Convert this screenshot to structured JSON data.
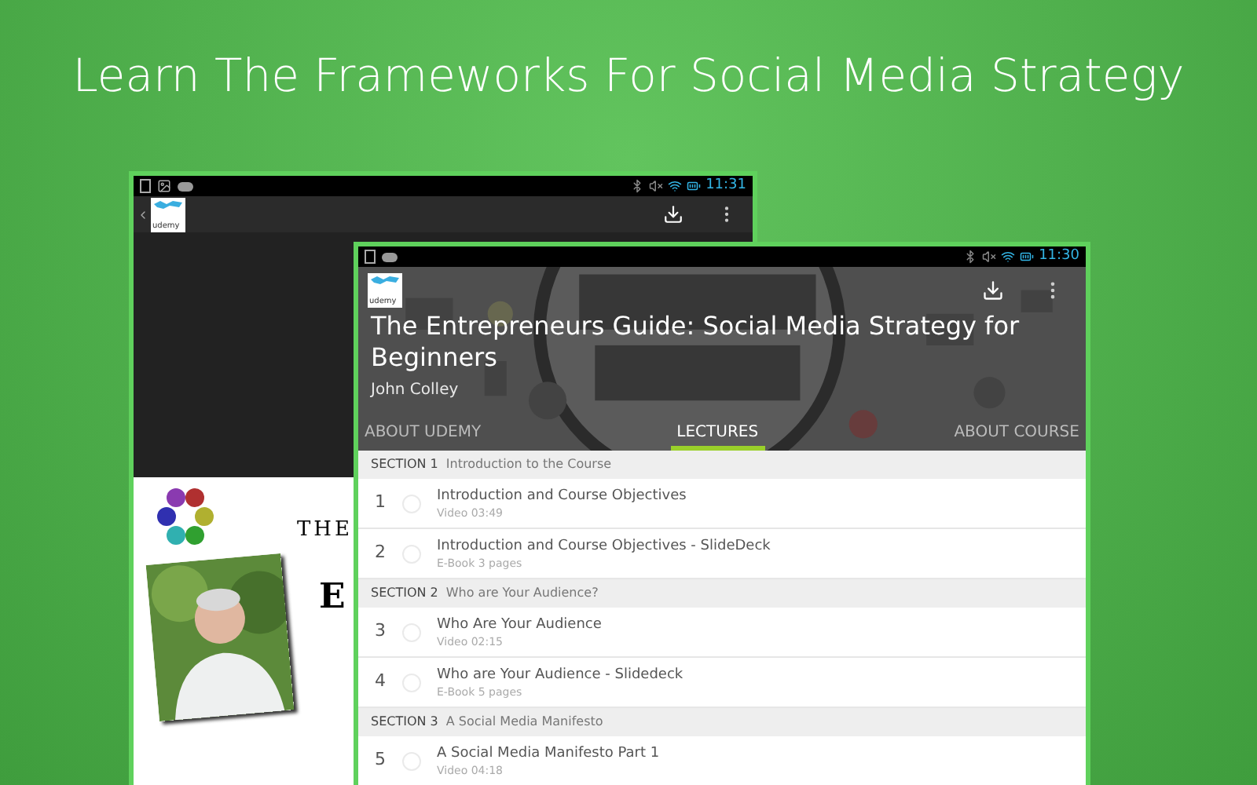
{
  "headline": "Learn The Frameworks For Social Media Strategy",
  "back_screen": {
    "status_time": "11:31",
    "logo_text": "udemy",
    "page_heading": "THE",
    "page_letter": "E"
  },
  "front_screen": {
    "status_time": "11:30",
    "logo_text": "udemy",
    "course_title": "The Entrepreneurs Guide: Social Media Strategy for Beginners",
    "author": "John Colley",
    "tabs": [
      {
        "label": "ABOUT UDEMY",
        "selected": false
      },
      {
        "label": "LECTURES",
        "selected": true
      },
      {
        "label": "ABOUT COURSE",
        "selected": false
      }
    ],
    "sections": [
      {
        "label": "SECTION 1",
        "title": "Introduction to the Course",
        "lectures": [
          {
            "number": "1",
            "title": "Introduction and Course Objectives",
            "meta": "Video 03:49"
          },
          {
            "number": "2",
            "title": "Introduction and Course Objectives - SlideDeck",
            "meta": "E-Book 3 pages"
          }
        ]
      },
      {
        "label": "SECTION 2",
        "title": "Who are Your Audience?",
        "lectures": [
          {
            "number": "3",
            "title": "Who Are Your Audience",
            "meta": "Video 02:15"
          },
          {
            "number": "4",
            "title": "Who are Your Audience - Slidedeck",
            "meta": "E-Book 5 pages"
          }
        ]
      },
      {
        "label": "SECTION 3",
        "title": "A Social Media Manifesto",
        "lectures": [
          {
            "number": "5",
            "title": "A Social Media Manifesto Part 1",
            "meta": "Video 04:18"
          }
        ]
      }
    ]
  }
}
